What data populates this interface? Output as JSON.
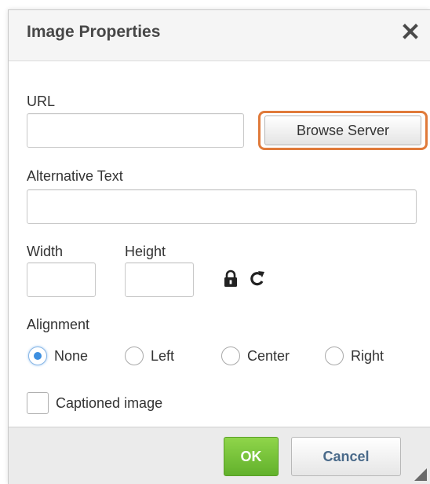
{
  "dialog": {
    "title": "Image Properties",
    "close_icon": "close-icon"
  },
  "form": {
    "url_label": "URL",
    "url_value": "",
    "browse_label": "Browse Server",
    "alt_label": "Alternative Text",
    "alt_value": "",
    "width_label": "Width",
    "width_value": "",
    "height_label": "Height",
    "height_value": "",
    "lock_icon": "lock-icon",
    "reset_icon": "reset-size-icon",
    "alignment_label": "Alignment",
    "alignment_options": [
      "None",
      "Left",
      "Center",
      "Right"
    ],
    "alignment_selected": "None",
    "caption_label": "Captioned image",
    "caption_checked": false
  },
  "footer": {
    "ok_label": "OK",
    "cancel_label": "Cancel"
  },
  "colors": {
    "highlight_ring": "#e07a3a",
    "ok_green": "#62b12c",
    "radio_blue": "#3d8fe0"
  }
}
